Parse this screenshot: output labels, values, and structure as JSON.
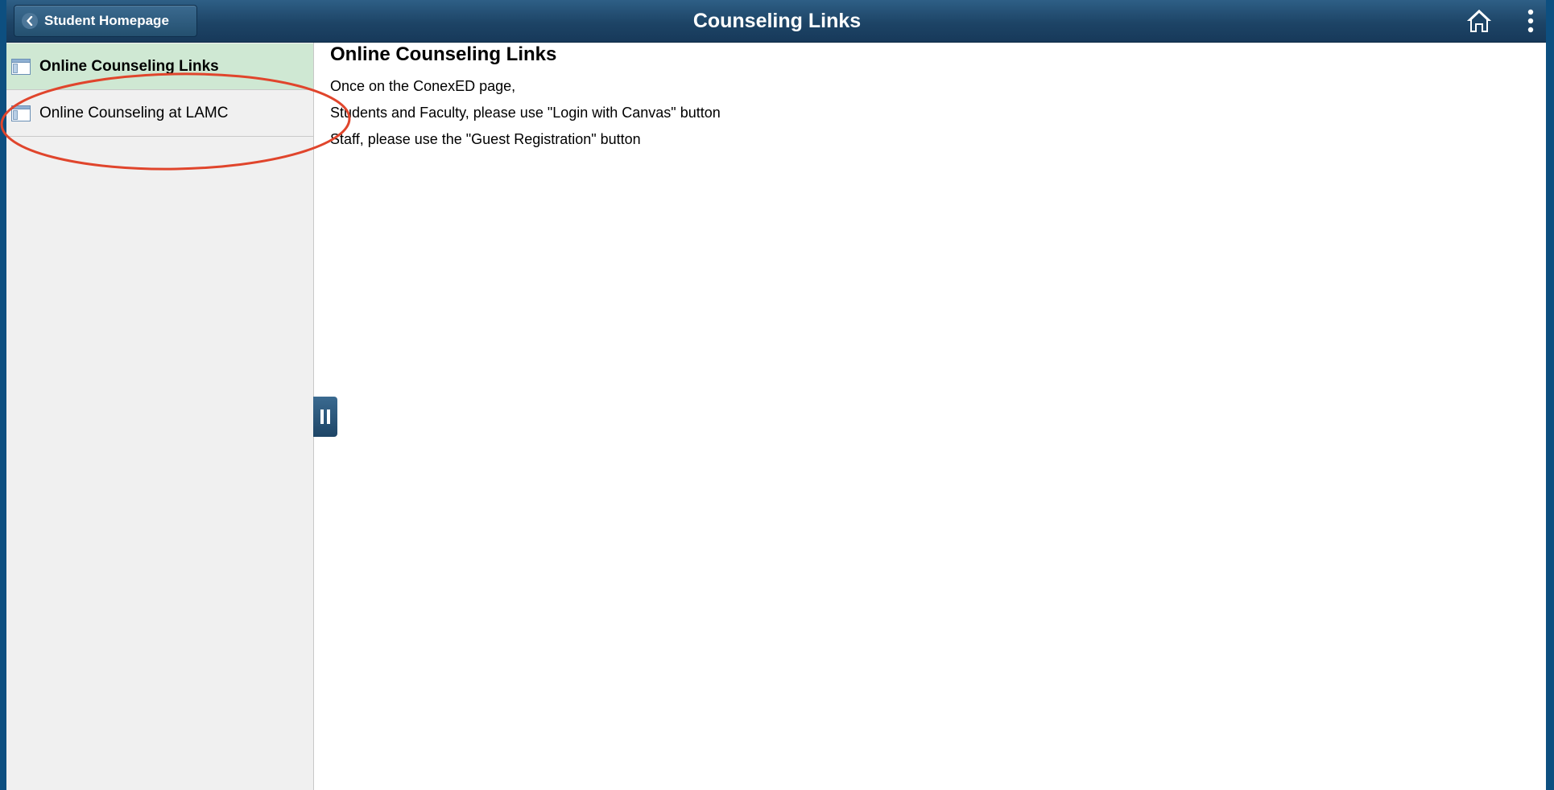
{
  "header": {
    "back_label": "Student Homepage",
    "title": "Counseling Links",
    "home_icon": "home-icon",
    "more_icon": "more-vertical-icon"
  },
  "sidebar": {
    "items": [
      {
        "label": "Online Counseling Links",
        "active": true,
        "icon": "page-icon"
      },
      {
        "label": "Online Counseling at LAMC",
        "active": false,
        "icon": "page-icon"
      }
    ]
  },
  "content": {
    "title": "Online Counseling Links",
    "lines": [
      "Once on the ConexED page,",
      "Students and Faculty, please use \"Login with Canvas\" button",
      "Staff, please use the \"Guest Registration\" button"
    ]
  },
  "colors": {
    "header": "#1d4466",
    "active_item": "#cfe8d3",
    "sidebar_bg": "#f0f0f0",
    "annotation": "#e0452c",
    "frame": "#0d4f80"
  }
}
